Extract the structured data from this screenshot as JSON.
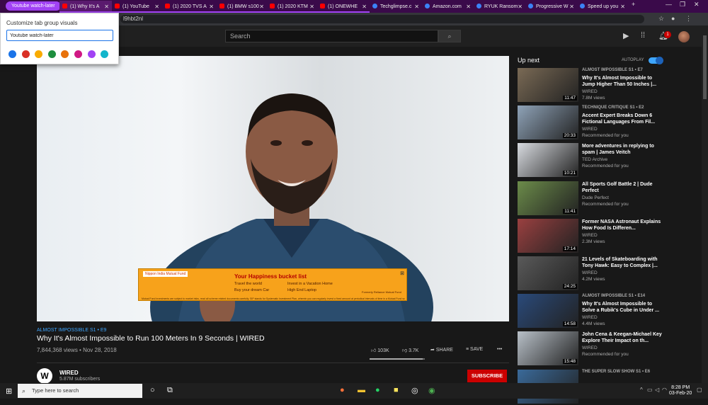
{
  "browser": {
    "tab_group": {
      "label": "Youtube watch-later"
    },
    "tabs": [
      {
        "label": "(1) Why It's A",
        "favicon": "youtube-icon",
        "in_group": true,
        "active": true
      },
      {
        "label": "(1) YouTube",
        "favicon": "youtube-icon",
        "in_group": true
      },
      {
        "label": "(1) 2020 TVS A",
        "favicon": "youtube-icon",
        "in_group": true
      },
      {
        "label": "(1) BMW s100",
        "favicon": "youtube-icon",
        "in_group": true
      },
      {
        "label": "(1) 2020 KTM",
        "favicon": "youtube-icon",
        "in_group": true
      },
      {
        "label": "(1) ONEWHE",
        "favicon": "youtube-icon",
        "in_group": true
      },
      {
        "label": "Techglimpse.c",
        "favicon": "site-icon",
        "in_group": false
      },
      {
        "label": "Amazon.com",
        "favicon": "site-icon",
        "in_group": false
      },
      {
        "label": "RYUK Ransom",
        "favicon": "site-icon",
        "in_group": false
      },
      {
        "label": "Progressive W",
        "favicon": "site-icon",
        "in_group": false
      },
      {
        "label": "Speed up you",
        "favicon": "site-icon",
        "in_group": false
      }
    ],
    "new_tab": "+",
    "url_fragment": "l9hbt2nl"
  },
  "popup": {
    "title": "Customize tab group visuals",
    "input_value": "Youtube watch-later",
    "colors": [
      "#1a73e8",
      "#d93025",
      "#f9ab00",
      "#1e8e3e",
      "#e8710a",
      "#d01884",
      "#a142f4",
      "#12b5cb"
    ]
  },
  "youtube": {
    "search_placeholder": "Search",
    "notification_count": "1",
    "video": {
      "tag": "ALMOST IMPOSSIBLE  S1 • E9",
      "title": "Why It's Almost Impossible to Run 100 Meters In 9 Seconds | WIRED",
      "meta": "7,844,368 views • Nov 28, 2018",
      "likes": "103K",
      "dislikes": "3.7K",
      "share": "SHARE",
      "save": "SAVE",
      "like_ratio": 0.965
    },
    "ad": {
      "brand": "Nippon India Mutual Fund",
      "headline": "Your Happiness bucket list",
      "bullets": [
        "Travel the world",
        "Invest in a Vacation Home",
        "Buy your dream Car",
        "High End Laptop"
      ],
      "tagline": "Formerly Reliance Mutual Fund",
      "fineprint": "Mutual Fund investments are subject to market risks, read all scheme related documents carefully. SIP stands for Systematic Investment Plan, wherein you can regularly invest a fixed amount at periodical intervals of time in a Mutual Fund scheme."
    },
    "channel": {
      "name": "WIRED",
      "subscribers": "5.87M subscribers",
      "subscribe_label": "SUBSCRIBE"
    },
    "up_next": {
      "label": "Up next",
      "autoplay_label": "AUTOPLAY",
      "autoplay_on": true,
      "items": [
        {
          "tag": "ALMOST IMPOSSIBLE  S1 • E7",
          "title": "Why It's Almost Impossible to Jump Higher Than 50 Inches |...",
          "channel": "WIRED",
          "views": "7.8M views",
          "duration": "11:47",
          "thumb": "#7a6a55"
        },
        {
          "tag": "TECHNIQUE CRITIQUE  S1 • E2",
          "title": "Accent Expert Breaks Down 6 Fictional Languages From Fil...",
          "channel": "WIRED",
          "views": "Recommended for you",
          "duration": "20:33",
          "thumb": "#8fa3b8"
        },
        {
          "tag": "",
          "title": "More adventures in replying to spam | James Veitch",
          "channel": "TED Archive",
          "views": "Recommended for you",
          "duration": "10:21",
          "thumb": "#d8dbe0"
        },
        {
          "tag": "",
          "title": "All Sports Golf Battle 2 | Dude Perfect",
          "channel": "Dude Perfect",
          "views": "Recommended for you",
          "duration": "11:41",
          "thumb": "#6c8c4a"
        },
        {
          "tag": "",
          "title": "Former NASA Astronaut Explains How Food Is Differen...",
          "channel": "WIRED",
          "views": "2.3M views",
          "duration": "17:14",
          "thumb": "#9a4040"
        },
        {
          "tag": "",
          "title": "21 Levels of Skateboarding with Tony Hawk: Easy to Complex |...",
          "channel": "WIRED",
          "views": "4.2M views",
          "duration": "24:25",
          "thumb": "#5a5a5a"
        },
        {
          "tag": "ALMOST IMPOSSIBLE  S1 • E14",
          "title": "Why It's Almost Impossible to Solve a Rubik's Cube in Under ...",
          "channel": "WIRED",
          "views": "4.4M views",
          "duration": "14:58",
          "thumb": "#2a4a7a"
        },
        {
          "tag": "",
          "title": "John Cena & Keegan-Michael Key Explore Their Impact on th...",
          "channel": "WIRED",
          "views": "Recommended for you",
          "duration": "15:48",
          "thumb": "#b8c0c8"
        },
        {
          "tag": "THE SUPER SLOW SHOW  S1 • E6",
          "title": "",
          "channel": "",
          "views": "",
          "duration": "",
          "thumb": "#3a6a9a"
        }
      ]
    }
  },
  "taskbar": {
    "search_placeholder": "Type here to search",
    "time": "8:28 PM",
    "date": "03-Feb-20"
  }
}
